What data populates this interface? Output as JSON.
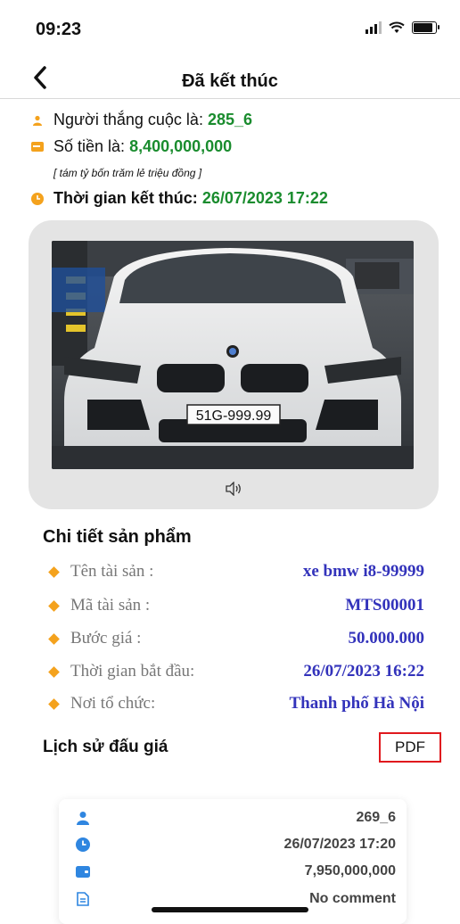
{
  "status_bar": {
    "time": "09:23"
  },
  "nav": {
    "title": "Đã kết thúc",
    "back_icon": "chevron-left-icon"
  },
  "summary": {
    "winner_label": "Người thắng cuộc là:",
    "winner_value": "285_6",
    "amount_label": "Số tiền là:",
    "amount_value": "8,400,000,000",
    "amount_words": "[ tám tỷ bốn trăm lẻ triệu đồng ]",
    "end_time_label": "Thời gian kết thúc:",
    "end_time_value": "26/07/2023 17:22"
  },
  "media": {
    "plate": "51G-999.99",
    "sound_icon": "speaker-icon"
  },
  "details": {
    "title": "Chi tiết sản phẩm",
    "rows": [
      {
        "label": "Tên tài sản :",
        "value": "xe bmw i8-99999"
      },
      {
        "label": "Mã tài sản :",
        "value": "MTS00001"
      },
      {
        "label": "Bước giá :",
        "value": "50.000.000"
      },
      {
        "label": "Thời gian bắt đầu:",
        "value": "26/07/2023 16:22"
      },
      {
        "label": "Nơi tổ chức:",
        "value": "Thanh phố Hà Nội"
      }
    ]
  },
  "history": {
    "title": "Lịch sử đấu giá",
    "pdf_label": "PDF",
    "entry": {
      "user": "269_6",
      "time": "26/07/2023 17:20",
      "amount": "7,950,000,000",
      "comment": "No comment"
    }
  },
  "colors": {
    "green": "#1a8c2e",
    "blue": "#3333bb",
    "orange": "#f4a21d",
    "pdf_border": "#e0191e",
    "history_icon": "#2f86e0"
  }
}
